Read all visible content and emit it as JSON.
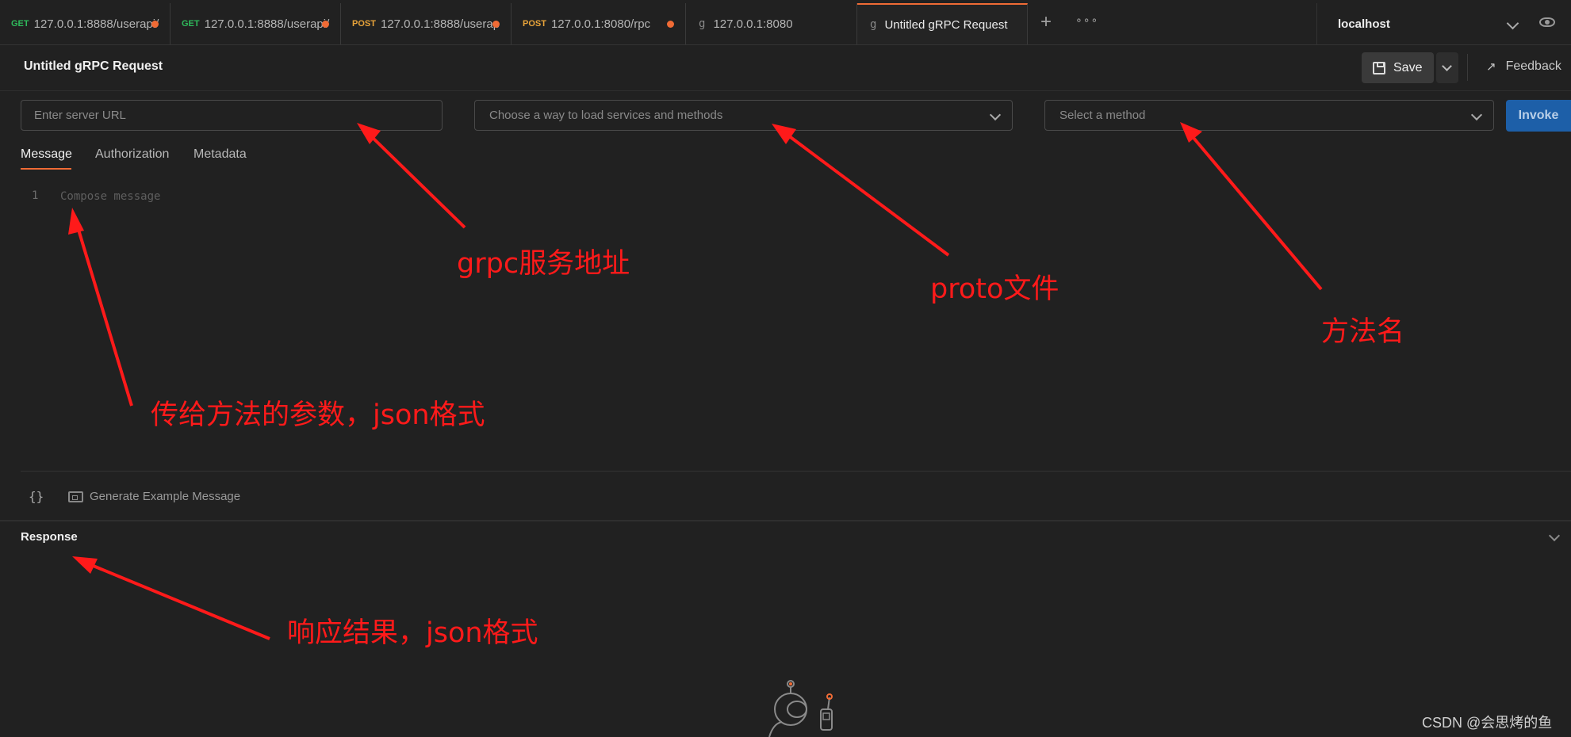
{
  "tabs": [
    {
      "method": "GET",
      "label": "127.0.0.1:8888/userapi/",
      "unsaved": true
    },
    {
      "method": "GET",
      "label": "127.0.0.1:8888/userapi/",
      "unsaved": true
    },
    {
      "method": "POST",
      "label": "127.0.0.1:8888/userap",
      "unsaved": true
    },
    {
      "method": "POST",
      "label": "127.0.0.1:8080/rpc",
      "unsaved": true
    },
    {
      "method": "",
      "label": "127.0.0.1:8080",
      "unsaved": false
    },
    {
      "method": "",
      "label": "Untitled gRPC Request",
      "unsaved": false,
      "active": true
    }
  ],
  "environment": {
    "name": "localhost"
  },
  "request": {
    "title": "Untitled gRPC Request",
    "save_label": "Save",
    "feedback_label": "Feedback",
    "url_placeholder": "Enter server URL",
    "services_placeholder": "Choose a way to load services and methods",
    "method_placeholder": "Select a method",
    "invoke_label": "Invoke"
  },
  "subtabs": [
    "Message",
    "Authorization",
    "Metadata"
  ],
  "editor": {
    "line_number": "1",
    "placeholder": "Compose message",
    "braces": "{}",
    "generate_label": "Generate Example Message"
  },
  "response": {
    "title": "Response"
  },
  "annotations": {
    "server_url": "grpc服务地址",
    "proto_file": "proto文件",
    "method_name": "方法名",
    "params": "传给方法的参数，json格式",
    "response": "响应结果，json格式"
  },
  "watermark": "CSDN @会思烤的鱼",
  "colors": {
    "accent": "#f06b35",
    "invoke": "#1d5fa8",
    "annotation": "#ff1a1a",
    "get": "#2fba5c",
    "post": "#e8a43a"
  }
}
